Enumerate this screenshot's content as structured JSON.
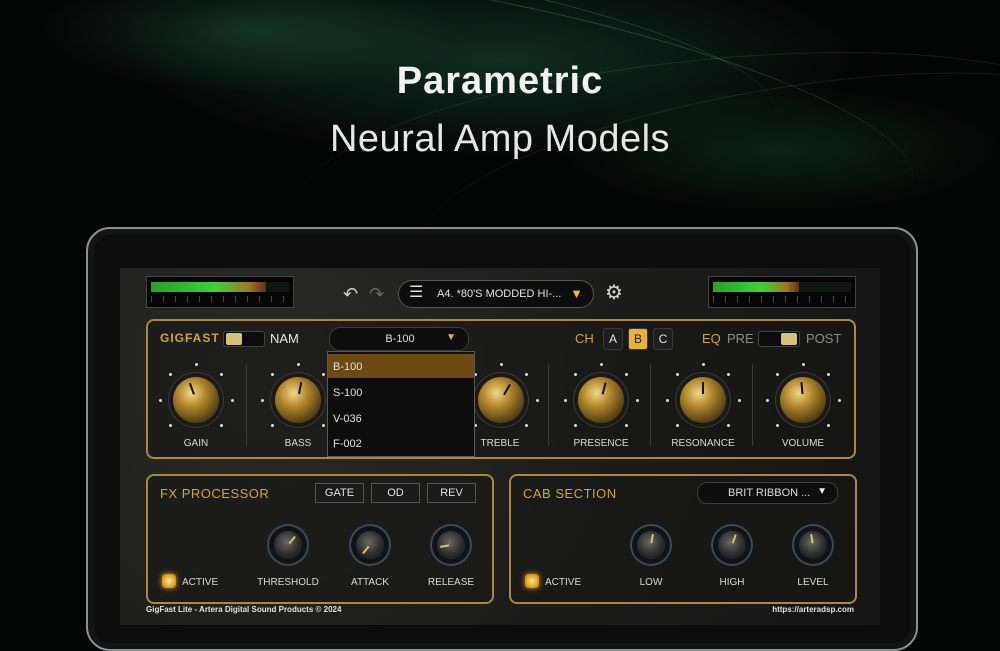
{
  "headline": {
    "title": "Parametric",
    "subtitle": "Neural Amp Models"
  },
  "toolbar": {
    "preset_name": "A4. *80'S MODDED HI-...",
    "input_level": 0.83,
    "output_level": 0.62
  },
  "amp": {
    "brand": "GIGFAST",
    "nam_label": "NAM",
    "model_selected": "B-100",
    "model_options": [
      "B-100",
      "S-100",
      "V-036",
      "F-002"
    ],
    "channel_label": "CH",
    "channels": [
      "A",
      "B",
      "C"
    ],
    "active_channel": "B",
    "eq_label": "EQ",
    "eq_pre": "PRE",
    "eq_post": "POST",
    "knobs": [
      "GAIN",
      "BASS",
      "TREBLE",
      "PRESENCE",
      "RESONANCE",
      "VOLUME"
    ]
  },
  "fx": {
    "title": "FX PROCESSOR",
    "buttons": [
      "GATE",
      "OD",
      "REV"
    ],
    "active_label": "ACTIVE",
    "knobs": [
      "THRESHOLD",
      "ATTACK",
      "RELEASE"
    ]
  },
  "cab": {
    "title": "CAB SECTION",
    "selected": "BRIT RIBBON ...",
    "active_label": "ACTIVE",
    "knobs": [
      "LOW",
      "HIGH",
      "LEVEL"
    ]
  },
  "footer": {
    "left": "GigFast Lite - Artera Digital Sound Products © 2024",
    "right": "https://arteradsp.com"
  },
  "colors": {
    "accent": "#d4a533",
    "active_button": "#e6b23c",
    "dropdown_highlight": "#6b4a13"
  }
}
